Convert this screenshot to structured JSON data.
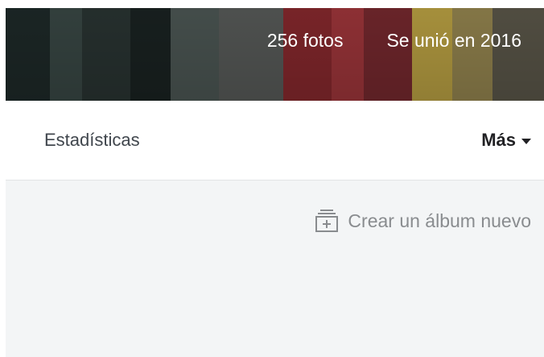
{
  "cover": {
    "photo_count": "256 fotos",
    "joined": "Se unió en 2016",
    "stripe_colors": [
      "#22302f",
      "#3c4b49",
      "#2c3836",
      "#56625f",
      "#4a4c4a",
      "#7c2a2c",
      "#a63a3e",
      "#8a2d33",
      "#6e4a3c",
      "#b8a03a",
      "#d2b84a",
      "#8a7c56",
      "#5a5448"
    ]
  },
  "subnav": {
    "stats_label": "Estadísticas",
    "more_label": "Más"
  },
  "content": {
    "create_album_label": "Crear un álbum nuevo",
    "create_album_icon": "add-album-icon"
  }
}
